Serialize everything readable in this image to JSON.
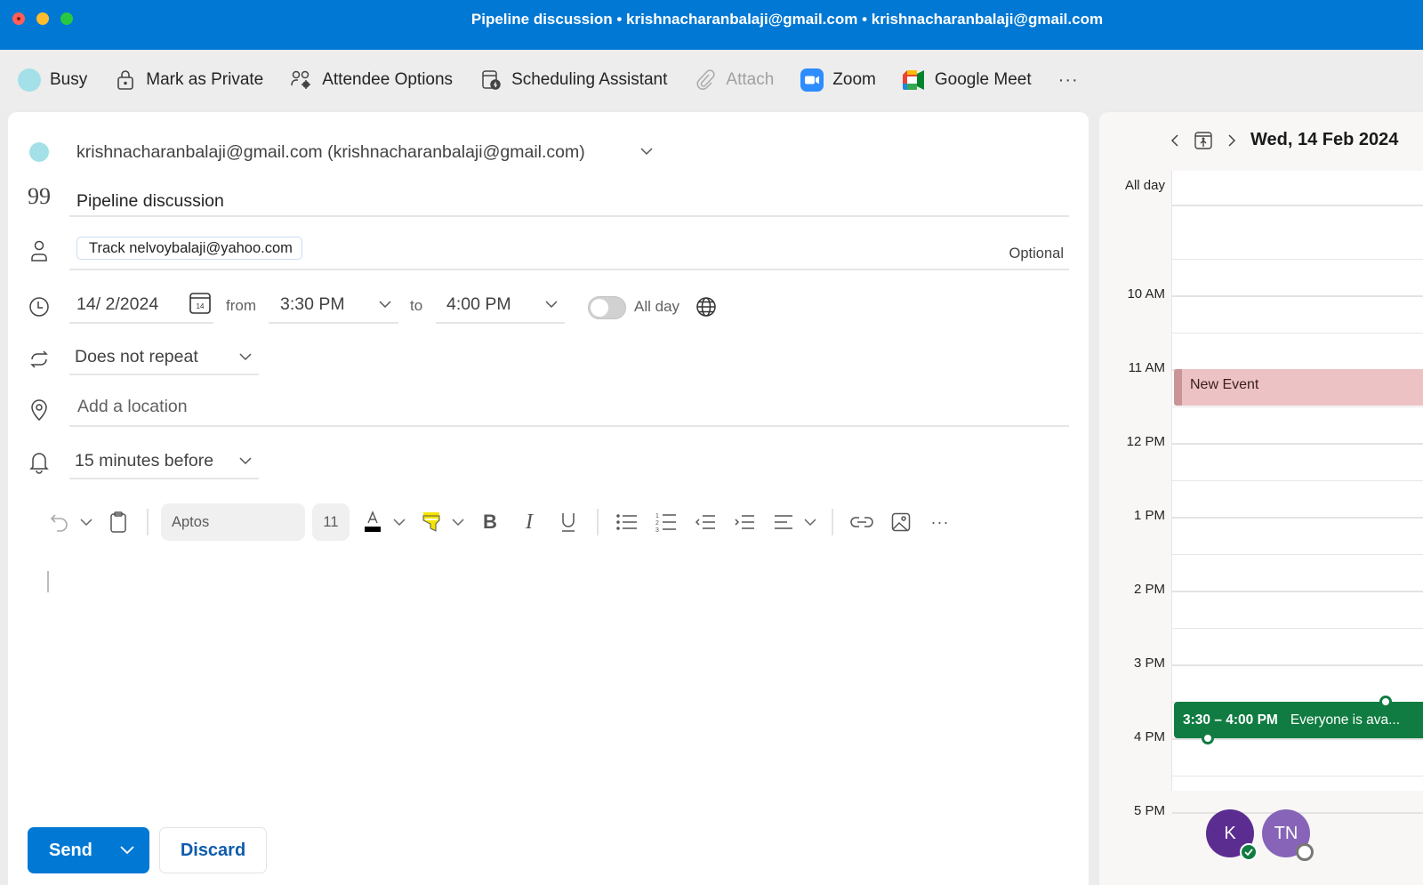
{
  "window": {
    "title": "Pipeline discussion • krishnacharanbalaji@gmail.com • krishnacharanbalaji@gmail.com"
  },
  "toolbar": {
    "items": [
      {
        "label": "Busy",
        "icon": "busy-status-dot"
      },
      {
        "label": "Mark as Private",
        "icon": "lock-icon"
      },
      {
        "label": "Attendee Options",
        "icon": "attendee-options-icon"
      },
      {
        "label": "Scheduling Assistant",
        "icon": "scheduling-assistant-icon"
      },
      {
        "label": "Attach",
        "icon": "paperclip-icon",
        "disabled": true
      },
      {
        "label": "Zoom",
        "icon": "zoom-icon"
      },
      {
        "label": "Google Meet",
        "icon": "google-meet-icon"
      }
    ],
    "more": "···"
  },
  "form": {
    "from": "krishnacharanbalaji@gmail.com (krishnacharanbalaji@gmail.com)",
    "title": "Pipeline discussion",
    "attendees": [
      "Track nelvoybalaji@yahoo.com"
    ],
    "optional_label": "Optional",
    "date": "14/ 2/2024",
    "calendar_icon_day": "14",
    "from_label": "from",
    "start_time": "3:30 PM",
    "to_label": "to",
    "end_time": "4:00 PM",
    "all_day_label": "All day",
    "all_day": false,
    "repeat": "Does not repeat",
    "location_placeholder": "Add a location",
    "reminder": "15 minutes before"
  },
  "format_toolbar": {
    "font": "Aptos",
    "size": "11",
    "text_color": "#000000",
    "highlight_color": "#f5e400"
  },
  "actions": {
    "send": "Send",
    "discard": "Discard"
  },
  "calendar": {
    "date": "Wed, 14 Feb 2024",
    "all_day_label": "All day",
    "hours": [
      "10 AM",
      "11 AM",
      "12 PM",
      "1 PM",
      "2 PM",
      "3 PM",
      "4 PM",
      "5 PM"
    ],
    "events": [
      {
        "title": "New Event",
        "start": "11:00",
        "end": "11:30",
        "color": "#ecc2c4"
      }
    ],
    "selection": {
      "time": "3:30 – 4:00 PM",
      "status": "Everyone is ava...",
      "color": "#107c41"
    },
    "attendees": [
      {
        "initials": "K",
        "color": "#5c2d91",
        "status": "accepted"
      },
      {
        "initials": "TN",
        "color": "#8764b8",
        "status": "unknown"
      }
    ]
  }
}
